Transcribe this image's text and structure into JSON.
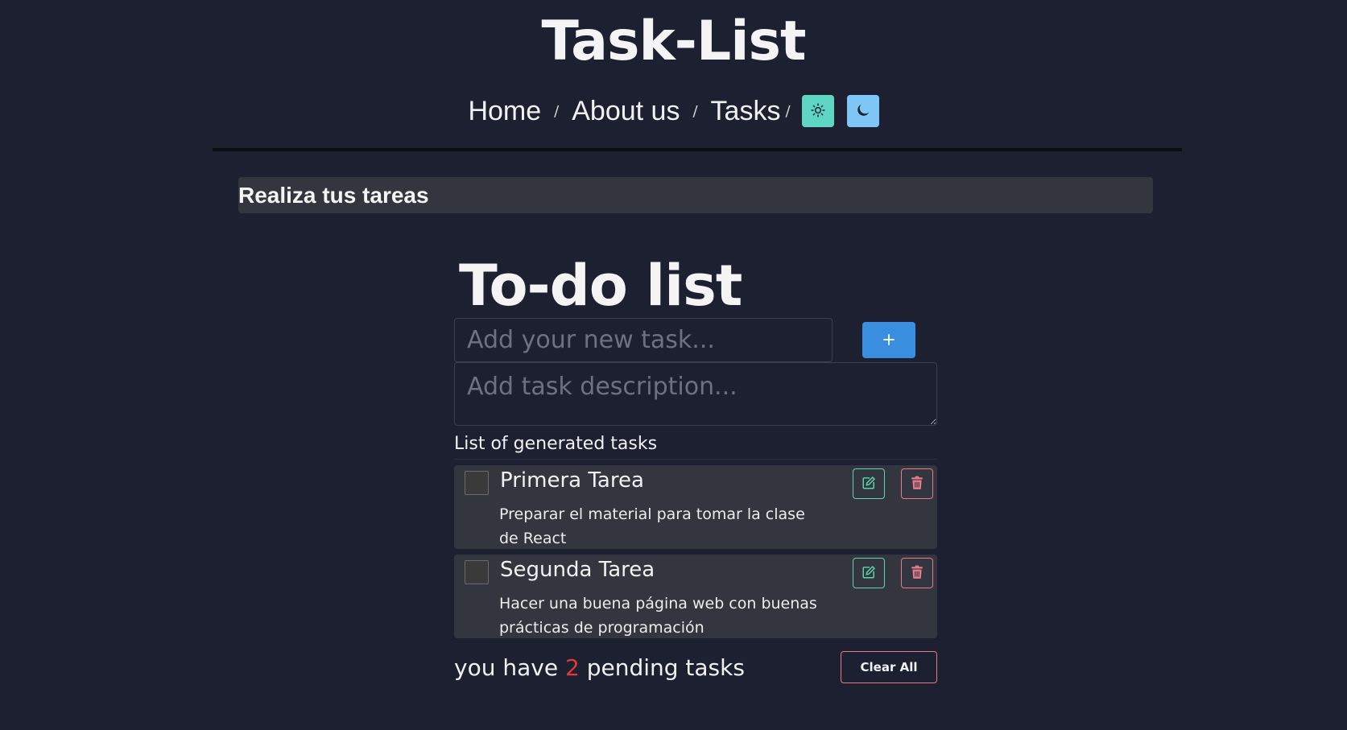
{
  "header": {
    "title": "Task-List",
    "nav": [
      {
        "label": "Home"
      },
      {
        "label": "About us"
      },
      {
        "label": "Tasks"
      }
    ],
    "separator": "/",
    "theme_light_icon": "sun-icon",
    "theme_dark_icon": "moon-icon"
  },
  "banner": {
    "text": "Realiza tus tareas"
  },
  "todo": {
    "title": "To-do list",
    "task_placeholder": "Add your new task...",
    "description_placeholder": "Add task description...",
    "add_label": "+",
    "list_heading": "List of generated tasks",
    "tasks": [
      {
        "name": "Primera Tarea",
        "description": "Preparar el material para tomar la clase de React",
        "completed": false
      },
      {
        "name": "Segunda Tarea",
        "description": "Hacer una buena página web con buenas prácticas de programación",
        "completed": false
      }
    ],
    "pending_prefix": "you have",
    "pending_count": "2",
    "pending_suffix": "pending tasks",
    "clear_label": "Clear All"
  },
  "colors": {
    "background": "#1c2030",
    "accent_add": "#3a8ee0",
    "edit_border": "#5fd6a8",
    "delete_border": "#e47c8e",
    "pending_count": "#e53935"
  }
}
